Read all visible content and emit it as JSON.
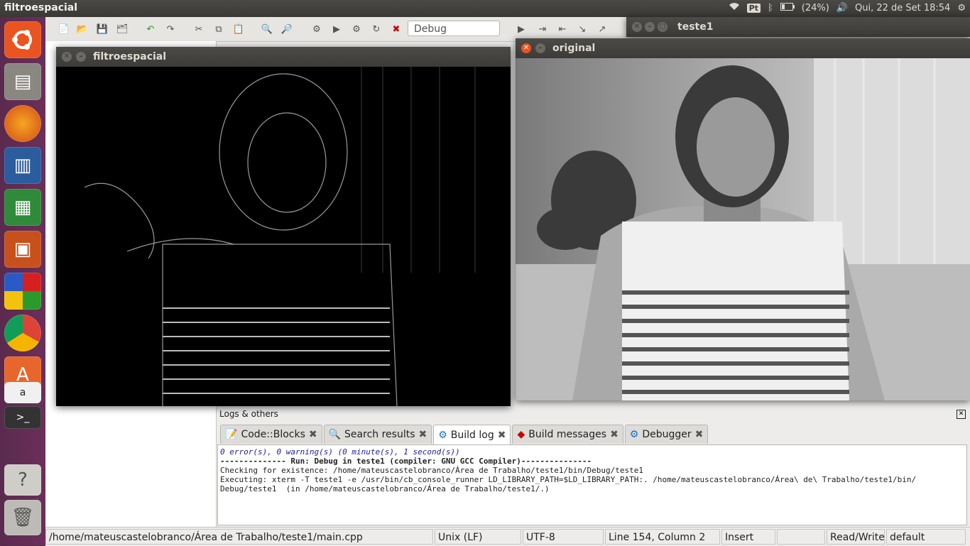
{
  "panel": {
    "app_title": "filtroespacial",
    "keyboard": "Pt",
    "battery": "(24%)",
    "clock": "Qui, 22 de Set 18:54"
  },
  "launcher": {
    "items": [
      "ubuntu-logo-icon",
      "files-icon",
      "firefox-icon",
      "writer-icon",
      "calc-icon",
      "impress-icon",
      "codeblocks-icon",
      "chrome-icon",
      "software-center-icon",
      "amazon-icon",
      "terminal-icon",
      "help-icon",
      "trash-icon"
    ]
  },
  "toolbar": {
    "build_target": "Debug"
  },
  "windows": {
    "filter": {
      "title": "filtroespacial"
    },
    "original": {
      "title": "original"
    },
    "teste1": {
      "title": "teste1"
    }
  },
  "logs": {
    "header": "Logs & others",
    "tabs": [
      {
        "label": "Code::Blocks",
        "icon": "note-icon"
      },
      {
        "label": "Search results",
        "icon": "search-icon"
      },
      {
        "label": "Build log",
        "icon": "gear-icon"
      },
      {
        "label": "Build messages",
        "icon": "pin-icon"
      },
      {
        "label": "Debugger",
        "icon": "gear-icon"
      }
    ],
    "lines": [
      "0 error(s), 0 warning(s) (0 minute(s), 1 second(s))",
      "",
      "",
      "-------------- Run: Debug in teste1 (compiler: GNU GCC Compiler)---------------",
      "",
      "Checking for existence: /home/mateuscastelobranco/Área de Trabalho/teste1/bin/Debug/teste1",
      "Executing: xterm -T teste1 -e /usr/bin/cb_console_runner LD_LIBRARY_PATH=$LD_LIBRARY_PATH:. /home/mateuscastelobranco/Área\\ de\\ Trabalho/teste1/bin/",
      "Debug/teste1  (in /home/mateuscastelobranco/Área de Trabalho/teste1/.)"
    ]
  },
  "status": {
    "path": "/home/mateuscastelobranco/Área de Trabalho/teste1/main.cpp",
    "eol": "Unix (LF)",
    "encoding": "UTF-8",
    "position": "Line 154, Column 2",
    "mode": "Insert",
    "rw": "Read/Write",
    "profile": "default"
  }
}
